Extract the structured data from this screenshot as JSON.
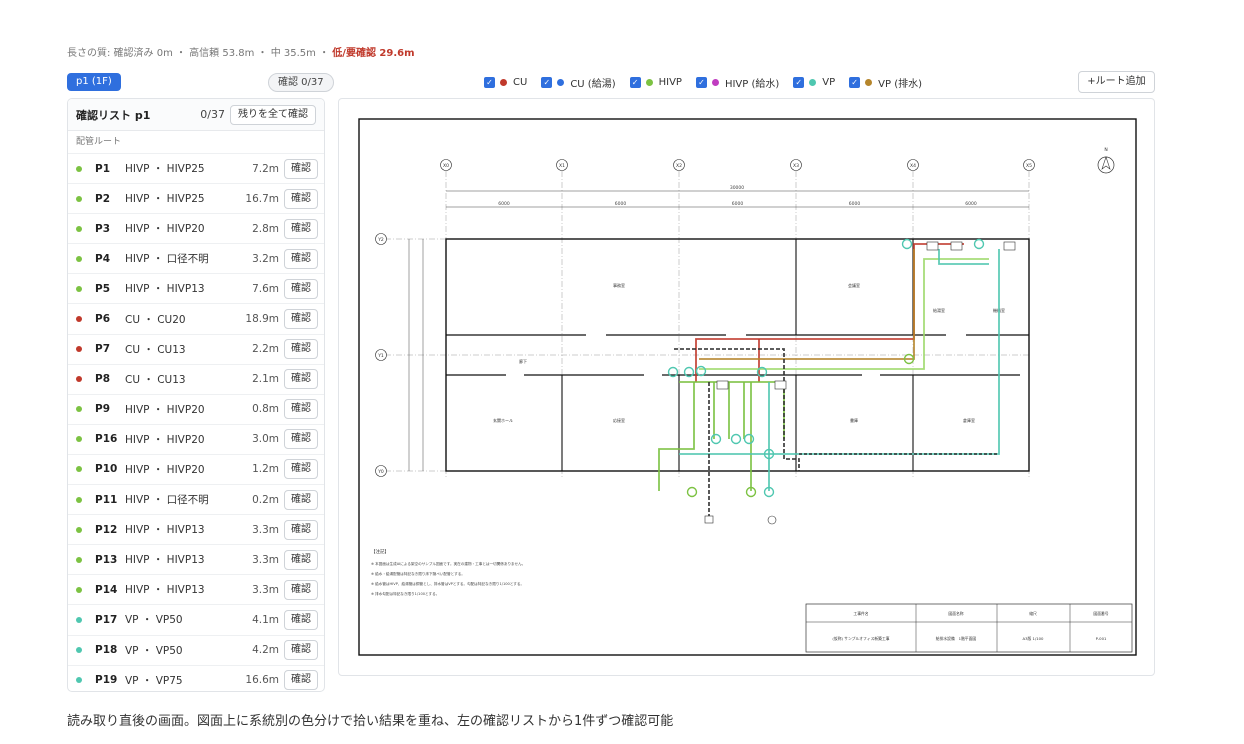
{
  "stats": {
    "prefix": "長さの質: 確認済み 0m ・ 高信頼 53.8m ・ 中 35.5m ・",
    "warn": "低/要確認 29.6m"
  },
  "page_button": "p1 (1F)",
  "confirm_pill": "確認 0/37",
  "legend": [
    {
      "label": "CU",
      "color": "#c0392b"
    },
    {
      "label": "CU (給湯)",
      "color": "#2f6fde"
    },
    {
      "label": "HIVP",
      "color": "#7cc242"
    },
    {
      "label": "HIVP (給水)",
      "color": "#c03cc0"
    },
    {
      "label": "VP",
      "color": "#4fc7b0"
    },
    {
      "label": "VP (排水)",
      "color": "#b5852b"
    }
  ],
  "add_route": "+ルート追加",
  "checklist": {
    "title": "確認リスト p1",
    "count": "0/37",
    "confirm_all": "残りを全て確認",
    "section": "配管ルート",
    "confirm_label": "確認",
    "rows": [
      {
        "id": "P1",
        "desc": "HIVP ・ HIVP25",
        "len": "7.2m",
        "color": "#7cc242"
      },
      {
        "id": "P2",
        "desc": "HIVP ・ HIVP25",
        "len": "16.7m",
        "color": "#7cc242"
      },
      {
        "id": "P3",
        "desc": "HIVP ・ HIVP20",
        "len": "2.8m",
        "color": "#7cc242"
      },
      {
        "id": "P4",
        "desc": "HIVP ・ 口径不明",
        "len": "3.2m",
        "color": "#7cc242"
      },
      {
        "id": "P5",
        "desc": "HIVP ・ HIVP13",
        "len": "7.6m",
        "color": "#7cc242"
      },
      {
        "id": "P6",
        "desc": "CU ・ CU20",
        "len": "18.9m",
        "color": "#c0392b"
      },
      {
        "id": "P7",
        "desc": "CU ・ CU13",
        "len": "2.2m",
        "color": "#c0392b"
      },
      {
        "id": "P8",
        "desc": "CU ・ CU13",
        "len": "2.1m",
        "color": "#c0392b"
      },
      {
        "id": "P9",
        "desc": "HIVP ・ HIVP20",
        "len": "0.8m",
        "color": "#7cc242"
      },
      {
        "id": "P16",
        "desc": "HIVP ・ HIVP20",
        "len": "3.0m",
        "color": "#7cc242"
      },
      {
        "id": "P10",
        "desc": "HIVP ・ HIVP20",
        "len": "1.2m",
        "color": "#7cc242"
      },
      {
        "id": "P11",
        "desc": "HIVP ・ 口径不明",
        "len": "0.2m",
        "color": "#7cc242"
      },
      {
        "id": "P12",
        "desc": "HIVP ・ HIVP13",
        "len": "3.3m",
        "color": "#7cc242"
      },
      {
        "id": "P13",
        "desc": "HIVP ・ HIVP13",
        "len": "3.3m",
        "color": "#7cc242"
      },
      {
        "id": "P14",
        "desc": "HIVP ・ HIVP13",
        "len": "3.3m",
        "color": "#7cc242"
      },
      {
        "id": "P17",
        "desc": "VP ・ VP50",
        "len": "4.1m",
        "color": "#4fc7b0"
      },
      {
        "id": "P18",
        "desc": "VP ・ VP50",
        "len": "4.2m",
        "color": "#4fc7b0"
      },
      {
        "id": "P19",
        "desc": "VP ・ VP75",
        "len": "16.6m",
        "color": "#4fc7b0"
      }
    ]
  },
  "drawing": {
    "grid_cols": [
      "X0",
      "X1",
      "X2",
      "X3",
      "X4",
      "X5"
    ],
    "grid_rows": [
      "Y2",
      "Y1",
      "Y0"
    ],
    "spans": [
      "6000",
      "6000",
      "6000",
      "6000",
      "6000"
    ],
    "total_span": "30000",
    "rooms": [
      "事務室",
      "会議室",
      "給湯室",
      "機械室",
      "廊下",
      "玄関ホール",
      "応接室",
      "書庫",
      "倉庫室"
    ],
    "north": "N",
    "notes_title": "【注記】",
    "notes": [
      "※ 本図面は生成AIによる架空のサンプル図面です。実在の建物・工事とは一切関係ありません。",
      "※ 給水・給湯配管は特記なき限り床下隠ぺい配管とする。",
      "※ 給水管はHIVP、給湯管は銅管とし、排水管はVPとする。勾配は特記なき限り1/100とする。",
      "※ 排水勾配は特記なき限り1/100とする。"
    ],
    "titleblock": {
      "headers": [
        "工事件名",
        "図面名称",
        "縮尺",
        "図面番号"
      ],
      "values": [
        "(仮称) サンプルオフィス新築工事",
        "給排水設備　1階平面図",
        "A3版 1/100",
        "P-001"
      ]
    }
  },
  "caption": "読み取り直後の画面。図面上に系統別の色分けで拾い結果を重ね、左の確認リストから1件ずつ確認可能"
}
